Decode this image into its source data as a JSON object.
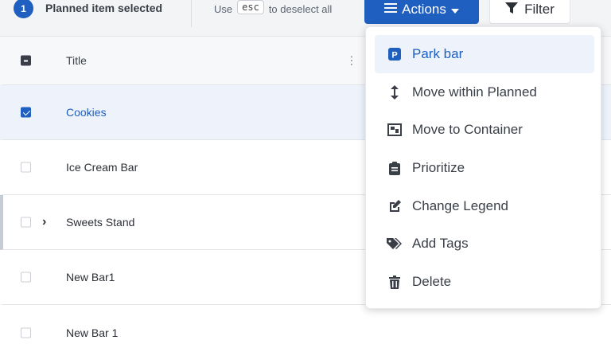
{
  "selection_bar": {
    "count": "1",
    "label": "Planned item selected",
    "hint_prefix": "Use",
    "hint_key": "esc",
    "hint_suffix": "to deselect all",
    "actions_label": "Actions",
    "filter_label": "Filter"
  },
  "table": {
    "header_title": "Title",
    "rows": [
      {
        "title": "Cookies",
        "checked": true
      },
      {
        "title": "Ice Cream Bar",
        "checked": false
      },
      {
        "title": "Sweets Stand",
        "checked": false,
        "expandable": true
      },
      {
        "title": "New Bar1",
        "checked": false
      },
      {
        "title": "New Bar 1",
        "checked": false
      }
    ]
  },
  "actions_menu": {
    "items": [
      {
        "label": "Park bar",
        "icon": "parking-icon",
        "active": true
      },
      {
        "label": "Move within Planned",
        "icon": "vertical-arrows-icon"
      },
      {
        "label": "Move to Container",
        "icon": "container-icon"
      },
      {
        "label": "Prioritize",
        "icon": "clipboard-icon"
      },
      {
        "label": "Change Legend",
        "icon": "edit-icon"
      },
      {
        "label": "Add Tags",
        "icon": "tags-icon"
      },
      {
        "label": "Delete",
        "icon": "trash-icon"
      }
    ]
  },
  "colors": {
    "accent": "#1f5fbf",
    "selected_row_bg": "#eef3fb"
  }
}
